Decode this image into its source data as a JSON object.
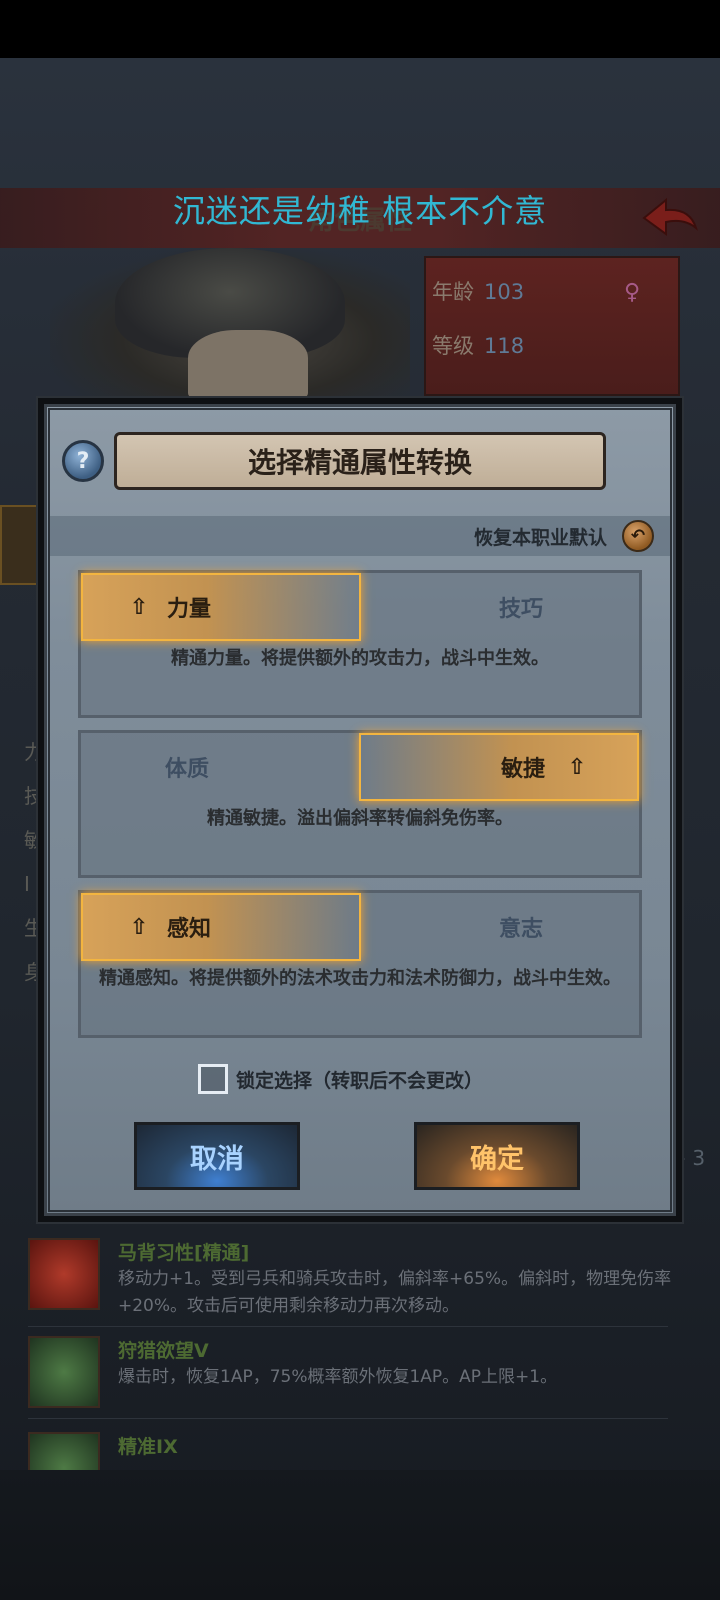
{
  "background": {
    "banner_title": "角色属性",
    "info": {
      "age_label": "年龄",
      "age_value": "103",
      "level_label": "等级",
      "level_value": "118"
    },
    "gender_icon": "♀",
    "side_letters": [
      "力",
      "技",
      "敏",
      "I",
      "生",
      "身"
    ],
    "right_number": "3",
    "skills": [
      {
        "name": "马背习性[精通]",
        "desc": "移动力+1。受到弓兵和骑兵攻击时，偏斜率+65%。偏斜时，物理免伤率+20%。攻击后可使用剩余移动力再次移动。",
        "icon": "horse-hoof-icon",
        "color": "#7a1c16"
      },
      {
        "name": "狩猎欲望V",
        "desc": "爆击时，恢复1AP，75%概率额外恢复1AP。AP上限+1。",
        "icon": "burst-icon",
        "color": "#2d4a2a"
      },
      {
        "name": "精准IX",
        "desc": "",
        "icon": "crosshair-icon",
        "color": "#2d4a2a"
      }
    ]
  },
  "subtitle": "沉迷还是幼稚 根本不介意",
  "dialog": {
    "help_symbol": "?",
    "title": "选择精通属性转换",
    "reset_label": "恢复本职业默认",
    "reset_icon": "undo-arrow-icon",
    "arrow_symbol": "⇧",
    "pairs": [
      {
        "left": "力量",
        "right": "技巧",
        "selected": "left",
        "desc": "精通力量。将提供额外的攻击力，战斗中生效。"
      },
      {
        "left": "体质",
        "right": "敏捷",
        "selected": "right",
        "desc": "精通敏捷。溢出偏斜率转偏斜免伤率。"
      },
      {
        "left": "感知",
        "right": "意志",
        "selected": "left",
        "desc": "精通感知。将提供额外的法术攻击力和法术防御力，战斗中生效。"
      }
    ],
    "lock_label": "锁定选择（转职后不会更改）",
    "lock_checked": false,
    "cancel_label": "取消",
    "confirm_label": "确定"
  },
  "colors": {
    "accent_gold": "#f3b540",
    "subtitle_cyan": "#31b8d3"
  }
}
